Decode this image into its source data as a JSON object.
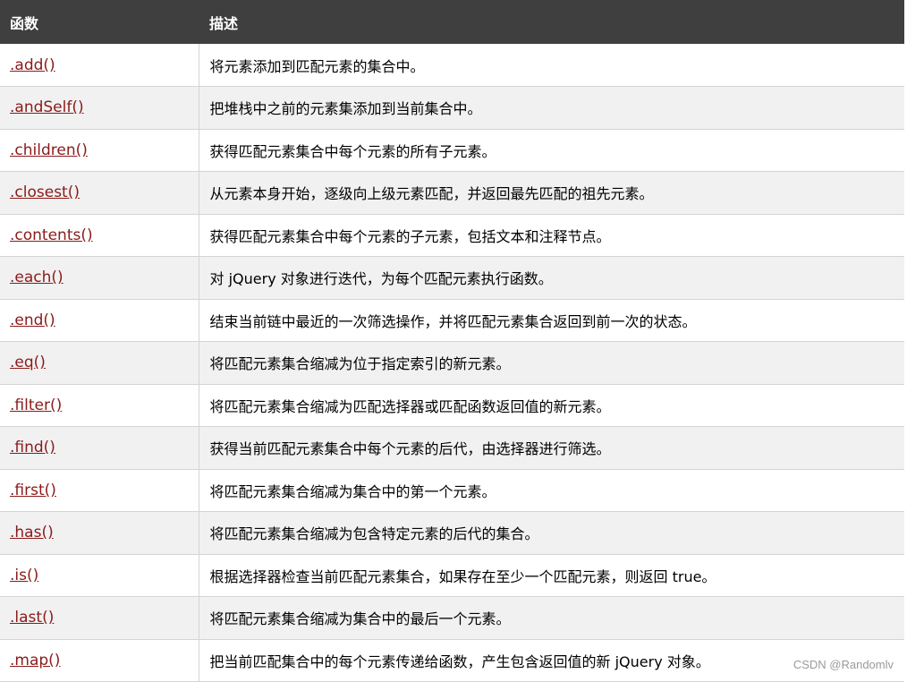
{
  "table": {
    "headers": [
      "函数",
      "描述"
    ],
    "rows": [
      {
        "fn": ".add()",
        "desc": "将元素添加到匹配元素的集合中。"
      },
      {
        "fn": ".andSelf()",
        "desc": "把堆栈中之前的元素集添加到当前集合中。"
      },
      {
        "fn": ".children()",
        "desc": "获得匹配元素集合中每个元素的所有子元素。"
      },
      {
        "fn": ".closest()",
        "desc": "从元素本身开始，逐级向上级元素匹配，并返回最先匹配的祖先元素。"
      },
      {
        "fn": ".contents()",
        "desc": "获得匹配元素集合中每个元素的子元素，包括文本和注释节点。"
      },
      {
        "fn": ".each()",
        "desc": "对 jQuery 对象进行迭代，为每个匹配元素执行函数。"
      },
      {
        "fn": ".end()",
        "desc": "结束当前链中最近的一次筛选操作，并将匹配元素集合返回到前一次的状态。"
      },
      {
        "fn": ".eq()",
        "desc": "将匹配元素集合缩减为位于指定索引的新元素。"
      },
      {
        "fn": ".filter()",
        "desc": "将匹配元素集合缩减为匹配选择器或匹配函数返回值的新元素。"
      },
      {
        "fn": ".find()",
        "desc": "获得当前匹配元素集合中每个元素的后代，由选择器进行筛选。"
      },
      {
        "fn": ".first()",
        "desc": "将匹配元素集合缩减为集合中的第一个元素。"
      },
      {
        "fn": ".has()",
        "desc": "将匹配元素集合缩减为包含特定元素的后代的集合。"
      },
      {
        "fn": ".is()",
        "desc": "根据选择器检查当前匹配元素集合，如果存在至少一个匹配元素，则返回 true。"
      },
      {
        "fn": ".last()",
        "desc": "将匹配元素集合缩减为集合中的最后一个元素。"
      },
      {
        "fn": ".map()",
        "desc": "把当前匹配集合中的每个元素传递给函数，产生包含返回值的新 jQuery 对象。"
      }
    ]
  },
  "watermark": "CSDN @Randomlv",
  "colors": {
    "header_bg": "#3f3f3f",
    "link": "#8b1a1a",
    "row_alt": "#f1f1f1"
  }
}
